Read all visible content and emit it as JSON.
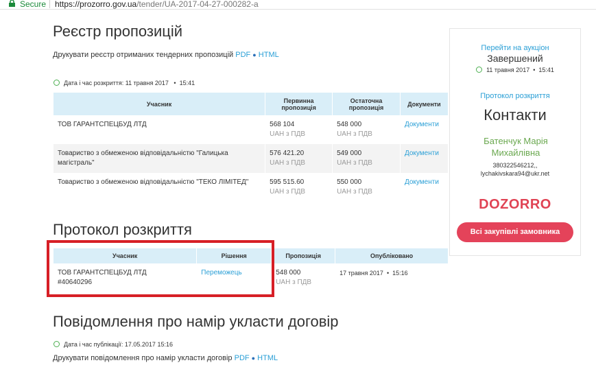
{
  "browser": {
    "secure_label": "Secure",
    "url_host": "https://prozorro.gov.ua",
    "url_path": "/tender/UA-2017-04-27-000282-a"
  },
  "registry": {
    "title": "Реєстр пропозицій",
    "print_text": "Друкувати реєстр отриманих тендерних пропозицій",
    "pdf_label": "PDF",
    "dot": "●",
    "html_label": "HTML",
    "opening_label": "Дата і час розкриття: 11 травня 2017",
    "opening_sep": "•",
    "opening_time": "15:41",
    "headers": {
      "participant": "Учасник",
      "initial": "Первинна пропозиція",
      "final": "Остаточна пропозиція",
      "documents": "Документи"
    },
    "rows": [
      {
        "participant": "ТОВ ГАРАНТСПЕЦБУД ЛТД",
        "initial": "568 104",
        "initial_vat": "UAH з ПДВ",
        "final": "548 000",
        "final_vat": "UAH з ПДВ",
        "documents": "Документи"
      },
      {
        "participant": "Товариство з обмеженою відповідальністю \"Галицька магістраль\"",
        "initial": "576 421.20",
        "initial_vat": "UAH з ПДВ",
        "final": "549 000",
        "final_vat": "UAH з ПДВ",
        "documents": "Документи"
      },
      {
        "participant": "Товариство з обмеженою відповідальністю \"ТЕКО ЛІМІТЕД\"",
        "initial": "595 515.60",
        "initial_vat": "UAH з ПДВ",
        "final": "550 000",
        "final_vat": "UAH з ПДВ",
        "documents": "Документи"
      }
    ]
  },
  "protocol": {
    "title": "Протокол розкриття",
    "headers": {
      "participant": "Учасник",
      "decision": "Рішення",
      "offer": "Пропозиція",
      "published": "Опубліковано"
    },
    "row": {
      "participant": "ТОВ ГАРАНТСПЕЦБУД ЛТД",
      "code": "#40640296",
      "decision": "Переможець",
      "offer": "548 000",
      "offer_vat": "UAH з ПДВ",
      "published_date": "17 травня 2017",
      "published_sep": "•",
      "published_time": "15:16"
    }
  },
  "notice": {
    "title": "Повідомлення про намір укласти договір",
    "published_label": "Дата і час публікації: 17.05.2017 15:16",
    "print_text": "Друкувати повідомлення про намір укласти договір",
    "pdf_label": "PDF",
    "dot": "●",
    "html_label": "HTML"
  },
  "sidebar": {
    "auction_link": "Перейти на аукціон",
    "status": "Завершений",
    "date": "11 травня 2017",
    "date_sep": "•",
    "time": "15:41",
    "protocol_link": "Протокол розкриття",
    "contacts_title": "Контакти",
    "person": "Батенчук Марія Михайлівна",
    "phone": "380322546212,,",
    "email": "lychakivskara94@ukr.net",
    "logo": "DOZORRO",
    "all_purchases_button": "Всі закупівлі замовника"
  },
  "colors": {
    "link": "#2a9fd6",
    "header_bg": "#d9eef8",
    "highlight": "#d71f26",
    "accent": "#e4435a",
    "secure": "#1b8a3a",
    "clock": "#4caf50"
  }
}
